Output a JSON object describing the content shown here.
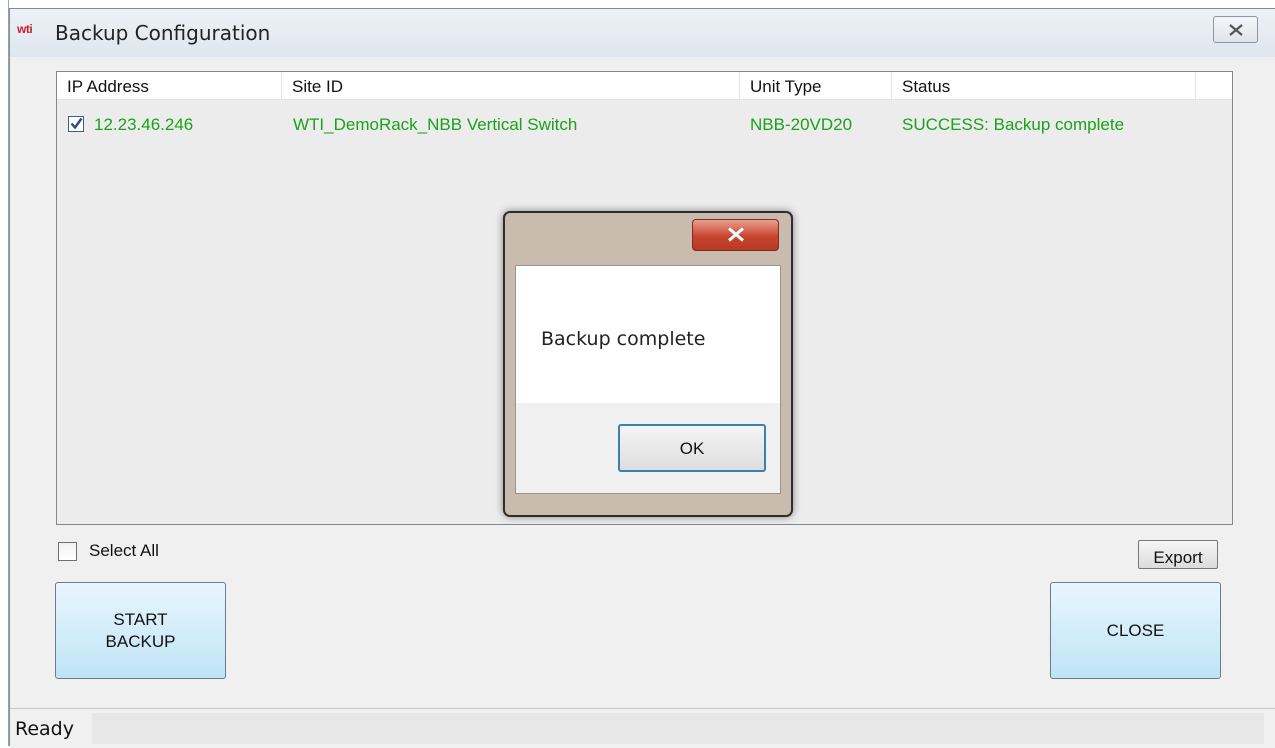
{
  "window": {
    "logo_text": "wti",
    "title": "Backup Configuration"
  },
  "device_list": {
    "columns": [
      "IP Address",
      "Site ID",
      "Unit Type",
      "Status"
    ],
    "rows": [
      {
        "checked": true,
        "ip_address": "12.23.46.246",
        "site_id": "WTI_DemoRack_NBB Vertical Switch",
        "unit_type": "NBB-20VD20",
        "status": "SUCCESS: Backup complete"
      }
    ]
  },
  "controls": {
    "select_all_label": "Select All",
    "select_all_checked": false,
    "export_label": "Export",
    "start_backup_line1": "START",
    "start_backup_line2": "BACKUP",
    "close_label": "CLOSE"
  },
  "status_bar": {
    "text": "Ready"
  },
  "message_box": {
    "message": "Backup complete",
    "ok_label": "OK"
  },
  "colors": {
    "success_text": "#1aa318",
    "button_fill": "#bfe4f6",
    "logo": "#cc1f2b"
  }
}
